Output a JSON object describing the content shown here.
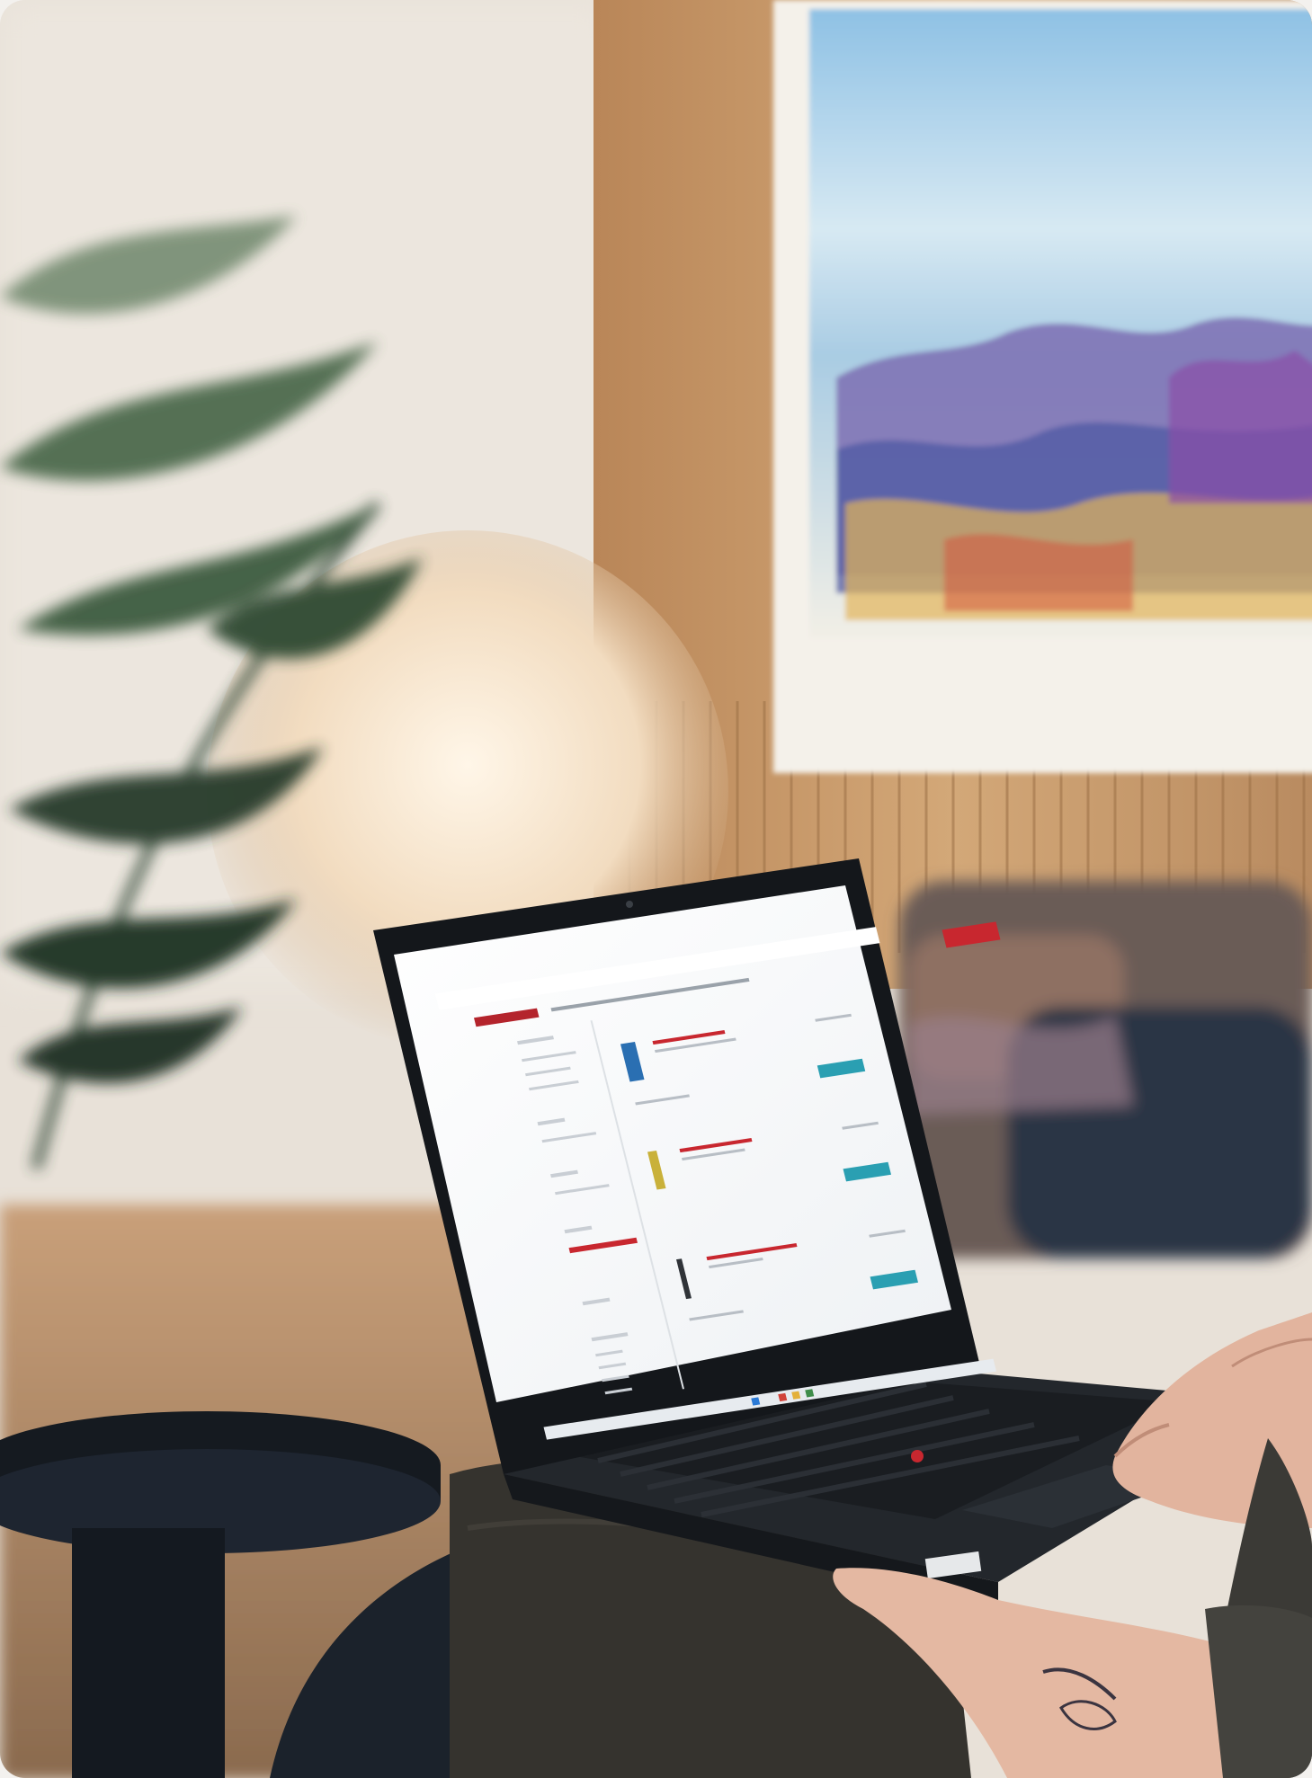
{
  "scene": {
    "subject": "laptop-on-lap",
    "colors": {
      "wall": "#e9e2da",
      "wood_panel": "#c79a6b",
      "painting_frame": "#f4f1ea",
      "lamp_glow": "#f6e6cf",
      "laptop_body": "#1f2327",
      "screen_bg": "#f7f7f9",
      "accent_red": "#c8272f",
      "accent_teal": "#2a9fb2",
      "skin": "#e4b8a2",
      "sleeve": "#3b3a36",
      "dark_furniture": "#1a1f24"
    }
  },
  "laptop_screen": {
    "logo_text": "",
    "sidebar": {},
    "products": [
      {},
      {},
      {}
    ]
  }
}
